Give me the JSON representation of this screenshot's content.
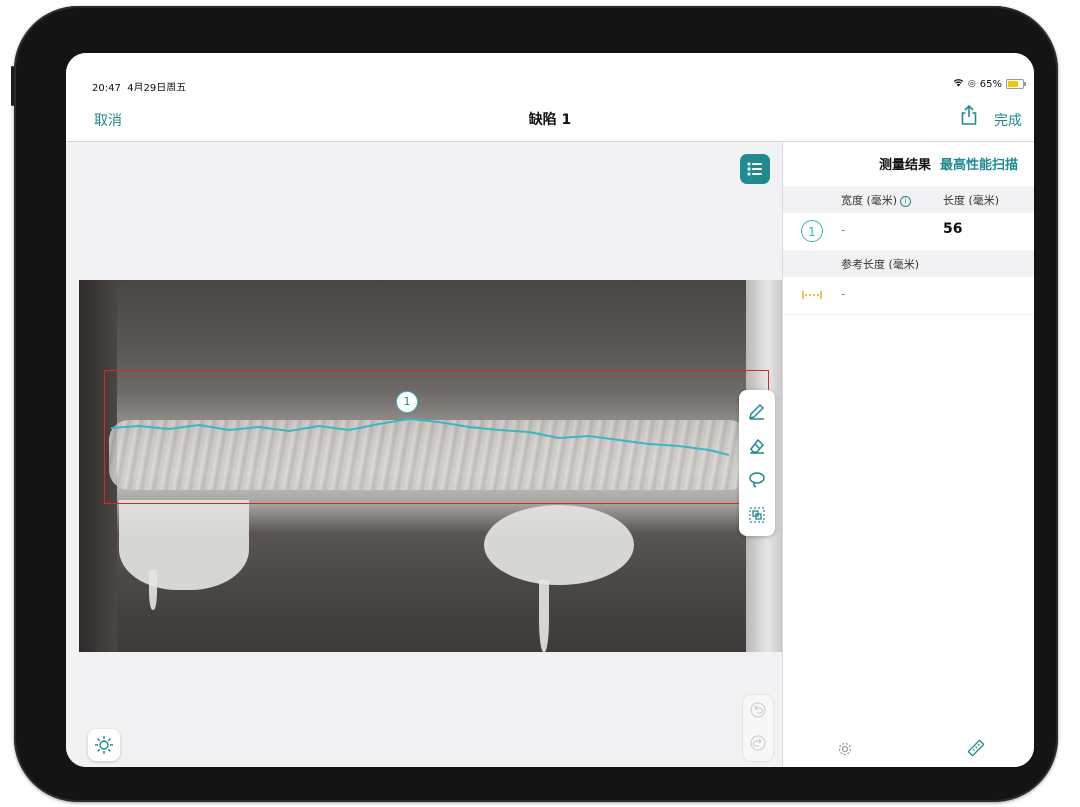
{
  "status_bar": {
    "time": "20:47",
    "date": "4月29日周五",
    "battery": "65%"
  },
  "nav": {
    "cancel": "取消",
    "title": "缺陷 1",
    "done": "完成"
  },
  "canvas": {
    "marker_number": "1"
  },
  "panel": {
    "title": "测量结果",
    "scan_link": "最高性能扫描",
    "col_width": "宽度 (毫米)",
    "col_length": "长度 (毫米)",
    "rows": [
      {
        "index": "1",
        "width": "-",
        "length": "56"
      }
    ],
    "ref_label": "参考长度 (毫米)",
    "ref_value": "-"
  },
  "colors": {
    "accent": "#1f8a8f",
    "detection_box": "#e02424",
    "crack_trace": "#3bb7c4",
    "reference": "#f0a800"
  },
  "icons": [
    "wifi-icon",
    "battery-icon",
    "share-icon",
    "list-icon",
    "pencil-icon",
    "eraser-icon",
    "lasso-icon",
    "select-region-icon",
    "undo-icon",
    "redo-icon",
    "brightness-icon",
    "gear-icon",
    "ruler-icon",
    "reference-length-icon"
  ]
}
